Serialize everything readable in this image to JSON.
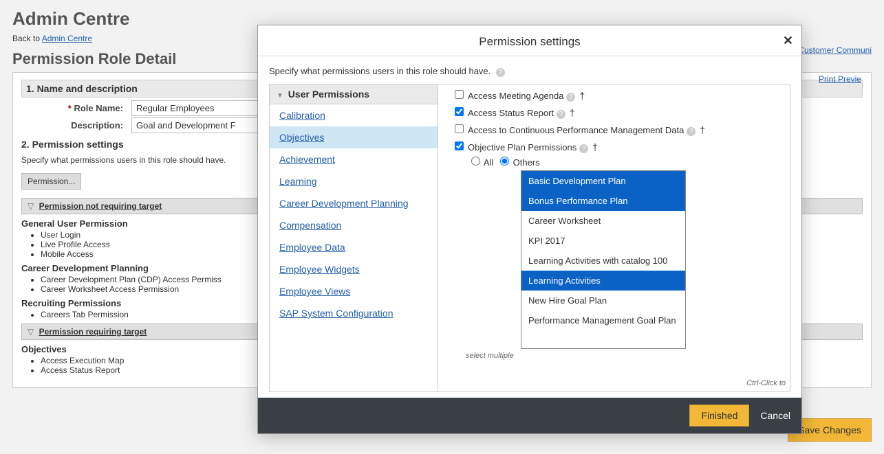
{
  "page": {
    "admin_title": "Admin Centre",
    "back_prefix": "Back to ",
    "back_link": "Admin Centre",
    "subtitle": "Permission Role Detail",
    "community_link": "p Customer Communi",
    "print_preview": "Print Previe",
    "section1": "1. Name and description",
    "role_name_label": "Role Name:",
    "role_name_value": "Regular Employees",
    "description_label": "Description:",
    "description_value": "Goal and Development F",
    "section2": "2. Permission settings",
    "specify_text": "Specify what permissions users in this role should have.",
    "perm_button": "Permission...",
    "bar_no_target": "Permission not requiring target",
    "bar_req_target": "Permission requiring target",
    "groups": {
      "general": {
        "title": "General User Permission",
        "items": [
          "User Login",
          "Live Profile Access",
          "Mobile Access"
        ]
      },
      "cdp": {
        "title": "Career Development Planning",
        "items": [
          "Career Development Plan (CDP) Access Permiss",
          "Career Worksheet Access Permission"
        ]
      },
      "recruiting": {
        "title": "Recruiting Permissions",
        "items": [
          "Careers Tab Permission"
        ]
      },
      "objectives": {
        "title": "Objectives",
        "items": [
          "Access Execution Map",
          "Access Status Report"
        ]
      }
    },
    "save_button": "Save Changes"
  },
  "dialog": {
    "title": "Permission settings",
    "specify": "Specify what permissions users in this role should have.",
    "cat_header": "User Permissions",
    "categories": [
      {
        "label": "Calibration",
        "selected": false
      },
      {
        "label": "Objectives",
        "selected": true
      },
      {
        "label": "Achievement",
        "selected": false
      },
      {
        "label": "Learning",
        "selected": false
      },
      {
        "label": "Career Development Planning",
        "selected": false
      },
      {
        "label": "Compensation",
        "selected": false
      },
      {
        "label": "Employee Data",
        "selected": false
      },
      {
        "label": "Employee Widgets",
        "selected": false
      },
      {
        "label": "Employee Views",
        "selected": false
      },
      {
        "label": "SAP System Configuration",
        "selected": false
      }
    ],
    "perms": [
      {
        "label": "Access Meeting Agenda",
        "checked": false,
        "dagger": true
      },
      {
        "label": "Access Status Report",
        "checked": true,
        "dagger": true
      },
      {
        "label": "Access to Continuous Performance Management Data",
        "checked": false,
        "dagger": true
      },
      {
        "label": "Objective Plan Permissions",
        "checked": true,
        "dagger": true
      }
    ],
    "radio": {
      "all": "All",
      "others": "Others",
      "selected": "others"
    },
    "plans": [
      {
        "label": "Basic Development Plan",
        "selected": true
      },
      {
        "label": "Bonus Performance Plan",
        "selected": true
      },
      {
        "label": "Career Worksheet",
        "selected": false
      },
      {
        "label": "KPI 2017",
        "selected": false
      },
      {
        "label": "Learning Activities with catalog 100",
        "selected": false
      },
      {
        "label": "Learning Activities",
        "selected": true
      },
      {
        "label": "New Hire Goal Plan",
        "selected": false
      },
      {
        "label": "Performance Management Goal Plan",
        "selected": false
      }
    ],
    "select_multiple": "select multiple",
    "ctrl_hint": "Ctrl-Click to",
    "footer": {
      "finished": "Finished",
      "cancel": "Cancel"
    }
  }
}
